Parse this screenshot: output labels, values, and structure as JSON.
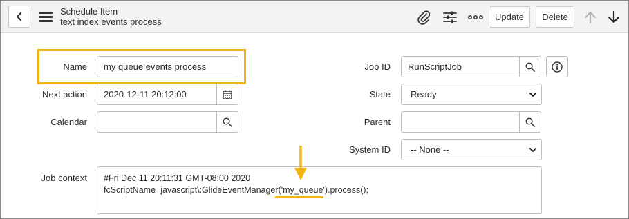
{
  "header": {
    "title": "Schedule Item",
    "subtitle": "text index events process",
    "update_label": "Update",
    "delete_label": "Delete",
    "icons": [
      "back-icon",
      "hamburger-icon",
      "paperclip-icon",
      "sliders-icon",
      "more-icon",
      "up-arrow-icon",
      "down-arrow-icon"
    ]
  },
  "form": {
    "name": {
      "label": "Name",
      "value": "my queue events process"
    },
    "next_action": {
      "label": "Next action",
      "value": "2020-12-11 20:12:00"
    },
    "calendar": {
      "label": "Calendar",
      "value": ""
    },
    "job_id": {
      "label": "Job ID",
      "value": "RunScriptJob"
    },
    "state": {
      "label": "State",
      "value": "Ready"
    },
    "parent": {
      "label": "Parent",
      "value": ""
    },
    "system_id": {
      "label": "System ID",
      "value": "-- None --"
    },
    "job_context": {
      "label": "Job context",
      "line1": "#Fri Dec 11 20:11:31 GMT-08:00 2020",
      "line2": "fcScriptName=javascript\\:GlideEventManager('my_queue').process();"
    }
  },
  "annotation": {
    "color": "#f2b314"
  }
}
